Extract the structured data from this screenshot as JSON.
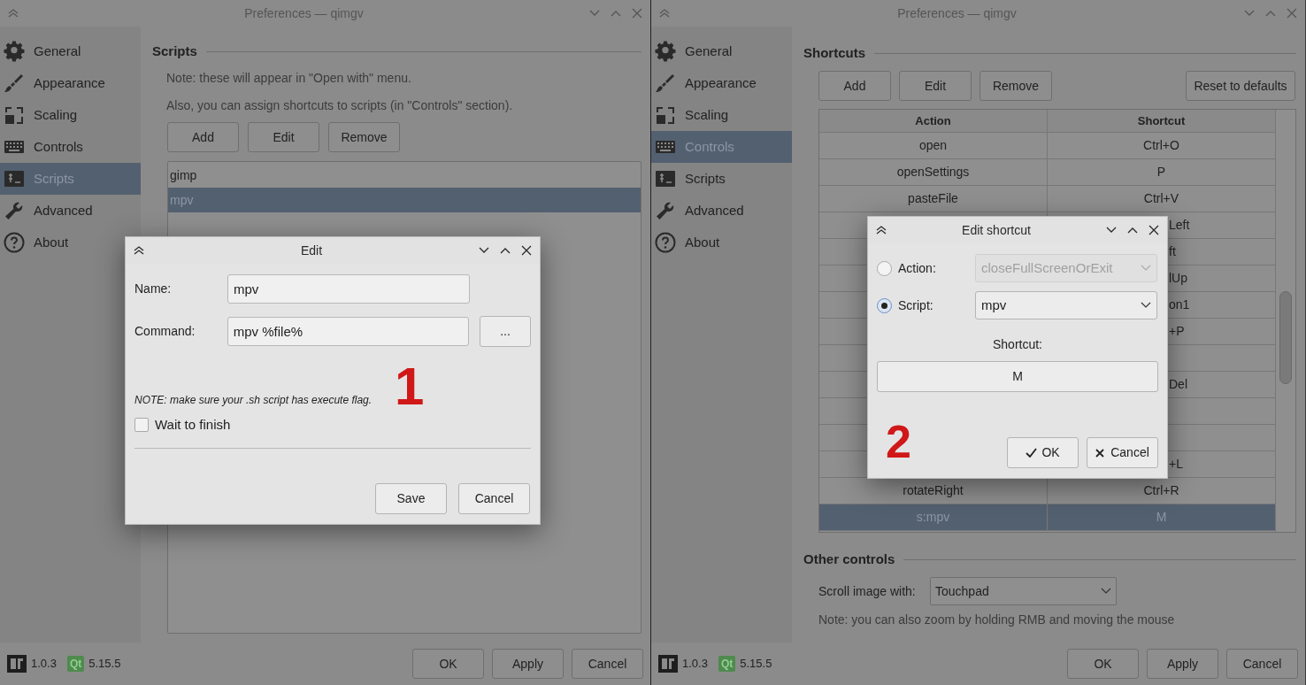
{
  "windows": [
    {
      "kind": "scripts",
      "title": "Preferences — qimgv",
      "sidebar": [
        {
          "label": "General",
          "selected": false
        },
        {
          "label": "Appearance",
          "selected": false
        },
        {
          "label": "Scaling",
          "selected": false
        },
        {
          "label": "Controls",
          "selected": false
        },
        {
          "label": "Scripts",
          "selected": true
        },
        {
          "label": "Advanced",
          "selected": false
        },
        {
          "label": "About",
          "selected": false
        }
      ],
      "section": "Scripts",
      "notes": [
        "Note: these will appear in \"Open with\" menu.",
        "Also, you can assign shortcuts to scripts (in \"Controls\" section)."
      ],
      "buttons": [
        "Add",
        "Edit",
        "Remove"
      ],
      "list": [
        {
          "label": "gimp",
          "selected": false
        },
        {
          "label": "mpv",
          "selected": true
        }
      ],
      "version": "1.0.3",
      "qt_badge": "Qt",
      "qt_version": "5.15.5",
      "footer_buttons": [
        "OK",
        "Apply",
        "Cancel"
      ]
    },
    {
      "kind": "controls",
      "title": "Preferences — qimgv",
      "sidebar": [
        {
          "label": "General",
          "selected": false
        },
        {
          "label": "Appearance",
          "selected": false
        },
        {
          "label": "Scaling",
          "selected": false
        },
        {
          "label": "Controls",
          "selected": true
        },
        {
          "label": "Scripts",
          "selected": false
        },
        {
          "label": "Advanced",
          "selected": false
        },
        {
          "label": "About",
          "selected": false
        }
      ],
      "section": "Shortcuts",
      "buttons": [
        "Add",
        "Edit",
        "Remove"
      ],
      "reset_button": "Reset to defaults",
      "table": {
        "columns": [
          "Action",
          "Shortcut"
        ],
        "rows": [
          {
            "action": "open",
            "shortcut": "Ctrl+O",
            "selected": false
          },
          {
            "action": "openSettings",
            "shortcut": "P",
            "selected": false
          },
          {
            "action": "pasteFile",
            "shortcut": "Ctrl+V",
            "selected": false
          },
          {
            "shortcut": "Left",
            "selected": false
          },
          {
            "shortcut": "ft",
            "selected": false
          },
          {
            "shortcut": "lUp",
            "selected": false
          },
          {
            "shortcut": "on1",
            "selected": false
          },
          {
            "shortcut": "+P",
            "selected": false
          },
          {
            "selected": false
          },
          {
            "shortcut": "Del",
            "selected": false
          },
          {
            "selected": false
          },
          {
            "selected": false
          },
          {
            "shortcut": "+L",
            "selected": false
          },
          {
            "action": "rotateRight",
            "shortcut": "Ctrl+R",
            "selected": false
          },
          {
            "action": "s:mpv",
            "shortcut": "M",
            "selected": true
          }
        ]
      },
      "other_section": "Other controls",
      "scroll_label": "Scroll image with:",
      "scroll_value": "Touchpad",
      "note": "Note: you can also zoom by holding RMB and moving the mouse",
      "version": "1.0.3",
      "qt_badge": "Qt",
      "qt_version": "5.15.5",
      "footer_buttons": [
        "OK",
        "Apply",
        "Cancel"
      ]
    }
  ],
  "dialogs": [
    {
      "kind": "edit_script",
      "title": "Edit",
      "name_label": "Name:",
      "name_value": "mpv",
      "command_label": "Command:",
      "command_value": "mpv %file%",
      "browse_button": "...",
      "note": "NOTE: make sure your .sh script has execute flag.",
      "marker": "1",
      "checkbox": {
        "label": "Wait to finish",
        "checked": false
      },
      "buttons": [
        "Save",
        "Cancel"
      ]
    },
    {
      "kind": "edit_shortcut",
      "title": "Edit shortcut",
      "options": [
        {
          "label": "Action:",
          "selected": false,
          "value": "closeFullScreenOrExit",
          "disabled": true
        },
        {
          "label": "Script:",
          "selected": true,
          "value": "mpv",
          "disabled": false
        }
      ],
      "shortcut_label": "Shortcut:",
      "shortcut_value": "M",
      "marker": "2",
      "ok_button": "OK",
      "cancel_button": "Cancel"
    }
  ]
}
